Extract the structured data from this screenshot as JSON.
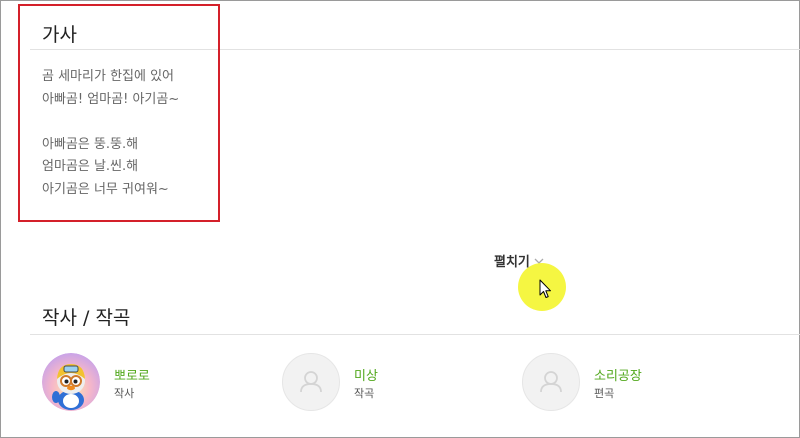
{
  "lyrics": {
    "title": "가사",
    "lines": [
      "곰 세마리가 한집에 있어",
      "아빠곰! 엄마곰! 아기곰~",
      "",
      "아빠곰은 뚱.뚱.해",
      "엄마곰은 날.씬.해",
      "아기곰은 너무 귀여워~"
    ],
    "expand_label": "펼치기"
  },
  "credits": {
    "title": "작사 / 작곡",
    "people": [
      {
        "name": "뽀로로",
        "role": "작사",
        "avatar": "pororo-character"
      },
      {
        "name": "미상",
        "role": "작곡",
        "avatar": "default-person-icon"
      },
      {
        "name": "소리공장",
        "role": "편곡",
        "avatar": "default-person-icon"
      }
    ]
  },
  "colors": {
    "accent_green": "#52a81d",
    "highlight_red": "#d4202a",
    "cursor_halo": "#f4f532"
  }
}
